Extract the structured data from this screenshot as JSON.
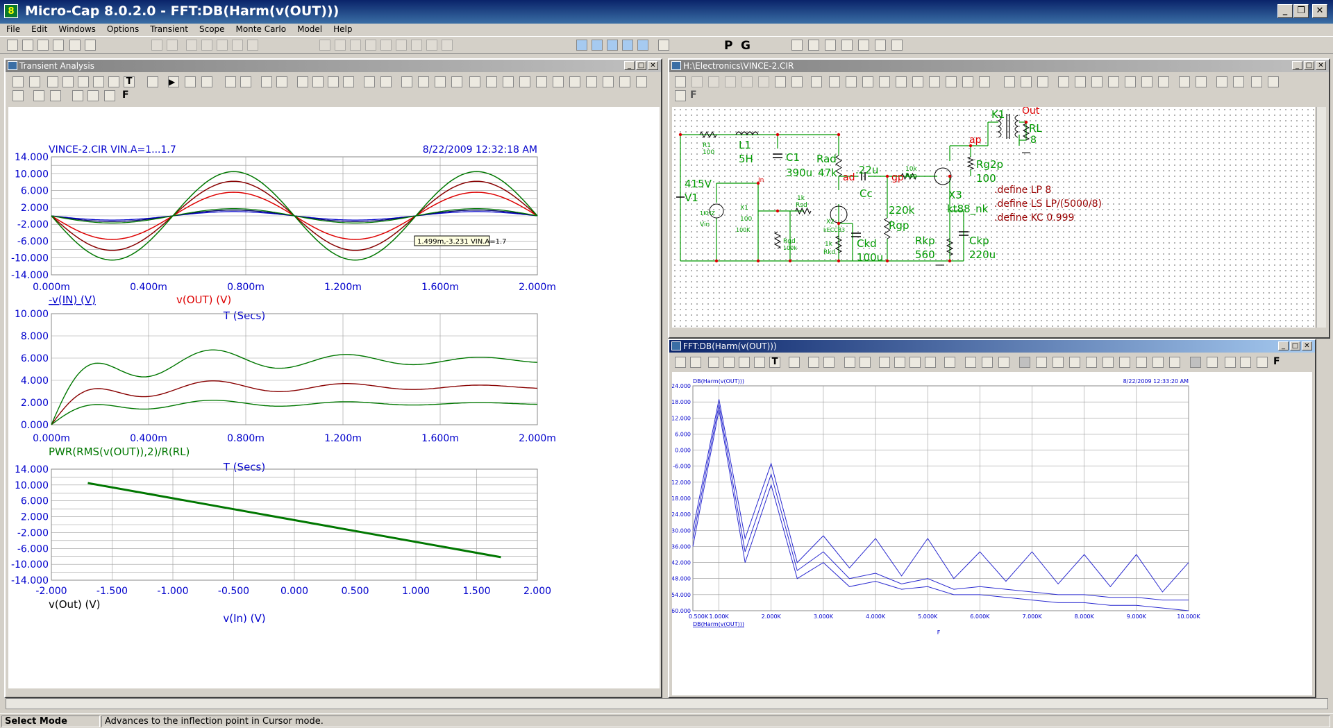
{
  "app": {
    "title": "Micro-Cap 8.0.2.0 - FFT:DB(Harm(v(OUT)))",
    "icon_text": "8"
  },
  "menu": [
    "File",
    "Edit",
    "Windows",
    "Options",
    "Transient",
    "Scope",
    "Monte Carlo",
    "Model",
    "Help"
  ],
  "toolbar": {
    "p_label": "P",
    "g_label": "G"
  },
  "transient": {
    "title": "Transient Analysis",
    "plot1": {
      "header_left": "VINCE-2.CIR VIN.A=1...1.7",
      "header_right": "8/22/2009 12:32:18 AM",
      "yticks": [
        "14.000",
        "10.000",
        "6.000",
        "2.000",
        "-2.000",
        "-6.000",
        "-10.000",
        "-14.000"
      ],
      "xticks": [
        "0.000m",
        "0.400m",
        "0.800m",
        "1.200m",
        "1.600m",
        "2.000m"
      ],
      "ylabel_left": "-v(IN) (V)",
      "ylabel_right": "v(OUT) (V)",
      "xlabel": "T (Secs)",
      "tooltip": "1.499m,-3.231 VIN.A=1.7"
    },
    "plot2": {
      "yticks": [
        "10.000",
        "8.000",
        "6.000",
        "4.000",
        "2.000",
        "0.000"
      ],
      "xticks": [
        "0.000m",
        "0.400m",
        "0.800m",
        "1.200m",
        "1.600m",
        "2.000m"
      ],
      "ylabel": "PWR(RMS(v(OUT)),2)/R(RL)",
      "xlabel": "T (Secs)"
    },
    "plot3": {
      "yticks": [
        "14.000",
        "10.000",
        "6.000",
        "2.000",
        "-2.000",
        "-6.000",
        "-10.000",
        "-14.000"
      ],
      "xticks": [
        "-2.000",
        "-1.500",
        "-1.000",
        "-0.500",
        "0.000",
        "0.500",
        "1.000",
        "1.500",
        "2.000"
      ],
      "ylabel": "v(Out) (V)",
      "xlabel": "v(In) (V)"
    }
  },
  "schematic": {
    "title": "H:\\Electronics\\VINCE-2.CIR",
    "labels": {
      "R1": "R1",
      "r1v": "100",
      "L1": "L1",
      "l1v": "5H",
      "C1": "C1",
      "c1v": "390u",
      "Rad": "Rad",
      "radv": "47k",
      "ad": "ad",
      "cc": "Cc",
      "ccv": ".22u",
      "gp": "gp",
      "rspv": "10k",
      "rsp": "Rsp",
      "V1": "V1",
      "v1v": "415V",
      "vin": "Vin",
      "vinv": "1KHZ",
      "in": "In",
      "X1": "X1",
      "x1v": "100",
      "x1v2": "100K",
      "rsdv": "1k",
      "rsd": "Rsd",
      "X2": "X2",
      "x2v": "kECC83",
      "rgd": "Rgd",
      "rgdv": "100k",
      "rkdv": "1k",
      "rkd": "Rkd",
      "Ckd": "Ckd",
      "ckdv": "100u",
      "rgp": "Rgp",
      "rgpv": "220k",
      "X3": "X3",
      "x3v": "kt88_nk",
      "rkp": "Rkp",
      "rkpv": "560",
      "ckp": "Ckp",
      "ckpv": "220u",
      "ap": "ap",
      "K1": "K1",
      "out": "Out",
      "RL": "RL",
      "rlv": "8",
      "rg2p": "Rg2p",
      "rg2pv": "100",
      "def1": ".define LP 8",
      "def2": ".define LS LP/(5000/8)",
      "def3": ".define KC 0.999"
    }
  },
  "fft": {
    "title": "FFT:DB(Harm(v(OUT)))",
    "header_left": "DB(Harm(v(OUT)))",
    "header_right": "8/22/2009 12:33:20 AM",
    "yticks": [
      "24.000",
      "18.000",
      "12.000",
      "6.000",
      "0.000",
      "-6.000",
      "-12.000",
      "-18.000",
      "-24.000",
      "-30.000",
      "-36.000",
      "-42.000",
      "-48.000",
      "-54.000",
      "-60.000"
    ],
    "xticks": [
      "0.500K",
      "1.000K",
      "2.000K",
      "3.000K",
      "4.000K",
      "5.000K",
      "6.000K",
      "7.000K",
      "8.000K",
      "9.000K",
      "10.000K"
    ],
    "ylabel": "DB(Harm(v(OUT)))",
    "xlabel": "F"
  },
  "status": {
    "mode": "Select Mode",
    "message": "Advances to the inflection point in Cursor mode."
  },
  "chart_data": [
    {
      "type": "line",
      "title": "VINCE-2.CIR VIN.A=1...1.7",
      "xlabel": "T (Secs)",
      "ylabel": "v(OUT) (V), -v(IN) (V)",
      "xlim": [
        0,
        2.0
      ],
      "ylim": [
        -14,
        14
      ],
      "x_unit": "ms",
      "series": [
        {
          "name": "v(OUT)",
          "amplitudes": [
            5.6,
            8.2,
            10.5
          ]
        },
        {
          "name": "-v(IN)",
          "amplitudes": [
            1.0,
            1.35,
            1.7
          ]
        }
      ]
    },
    {
      "type": "line",
      "ylabel": "PWR(RMS(v(OUT)),2)/R(RL)",
      "xlabel": "T (Secs)",
      "xlim": [
        0,
        2.0
      ],
      "ylim": [
        0,
        10
      ],
      "series": [
        {
          "final": [
            1.9,
            3.4,
            5.8
          ]
        }
      ]
    },
    {
      "type": "line",
      "xlabel": "v(In) (V)",
      "ylabel": "v(Out) (V)",
      "xlim": [
        -2,
        2
      ],
      "ylim": [
        -14,
        14
      ],
      "series": [
        {
          "x": [
            -1.7,
            1.7
          ],
          "y": [
            10.5,
            -8.2
          ]
        }
      ]
    },
    {
      "type": "line",
      "title": "DB(Harm(v(OUT)))",
      "xlabel": "F",
      "xlim": [
        0.5,
        10
      ],
      "ylim": [
        -60,
        24
      ],
      "x": [
        0.5,
        1,
        1.5,
        2,
        2.5,
        3,
        3.5,
        4,
        4.5,
        5,
        5.5,
        6,
        6.5,
        7,
        7.5,
        8,
        8.5,
        9,
        9.5,
        10
      ],
      "series": [
        {
          "values": [
            -30,
            19,
            -33,
            -5,
            -42,
            -32,
            -44,
            -33,
            -47,
            -33,
            -48,
            -38,
            -49,
            -38,
            -50,
            -39,
            -51,
            -39,
            -53,
            -42
          ]
        },
        {
          "values": [
            -33,
            17,
            -38,
            -9,
            -45,
            -38,
            -48,
            -46,
            -50,
            -48,
            -52,
            -51,
            -52,
            -53,
            -54,
            -54,
            -55,
            -55,
            -56,
            -56
          ]
        },
        {
          "values": [
            -36,
            15,
            -42,
            -13,
            -48,
            -42,
            -51,
            -49,
            -52,
            -51,
            -54,
            -54,
            -55,
            -56,
            -57,
            -57,
            -58,
            -58,
            -59,
            -60
          ]
        }
      ]
    }
  ]
}
